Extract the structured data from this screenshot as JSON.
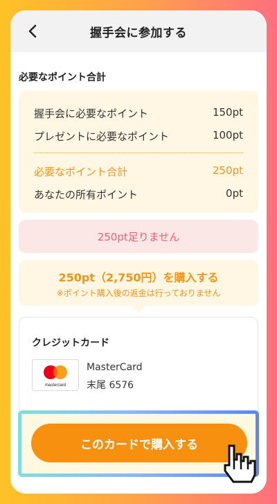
{
  "header": {
    "title": "握手会に参加する",
    "back_icon": "chevron-left-icon"
  },
  "summary": {
    "label": "必要なポイント合計",
    "rows": [
      {
        "label": "握手会に必要なポイント",
        "value": "150pt"
      },
      {
        "label": "プレゼントに必要なポイント",
        "value": "100pt"
      },
      {
        "label": "必要なポイント合計",
        "value": "250pt"
      },
      {
        "label": "あなたの所有ポイント",
        "value": "0pt"
      }
    ]
  },
  "shortage": {
    "text": "250pt足りません"
  },
  "purchase": {
    "main": "250pt（2,750円）を購入する",
    "note": "※ポイント購入後の返金は行っておりません"
  },
  "card": {
    "title": "クレジットカード",
    "brand": "MasterCard",
    "logo_text": "mastercard",
    "tail": "末尾 6576"
  },
  "cta": {
    "label": "このカードで購入する"
  },
  "colors": {
    "accent": "#F7900E",
    "warning": "#F0606B",
    "summary_bg": "#FFF6E3"
  }
}
